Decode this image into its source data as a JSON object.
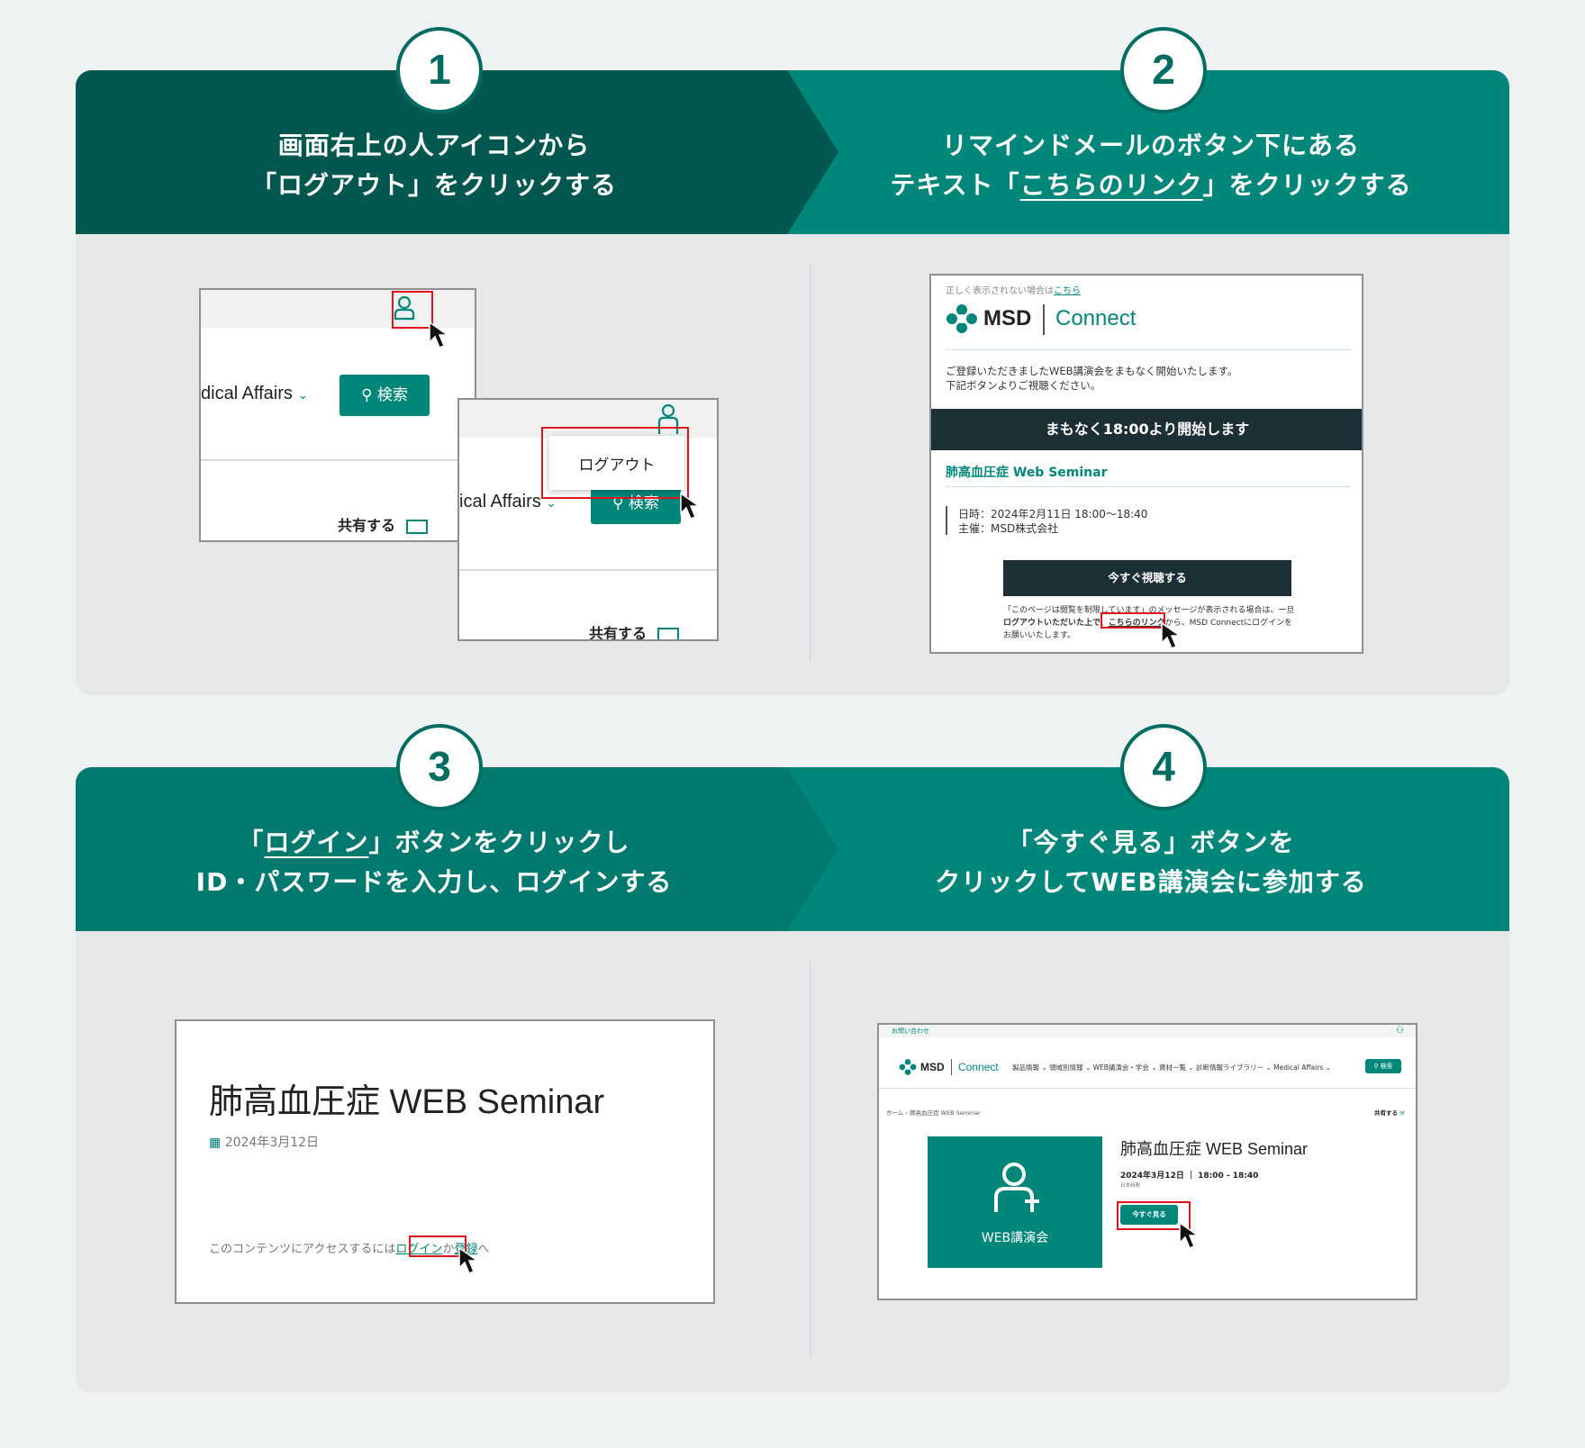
{
  "colors": {
    "accent": "#00877a",
    "dark_header": "#02574f",
    "badge": "#016c61",
    "highlight": "#e0161d",
    "banner": "#1c2f35"
  },
  "steps": [
    {
      "number": "1",
      "line1": "画面右上の人アイコンから",
      "line2": "「ログアウト」をクリックする"
    },
    {
      "number": "2",
      "line1": "リマインドメールのボタン下にある",
      "line2_pre": "テキスト「",
      "line2_link": "こちらのリンク",
      "line2_post": "」をクリックする"
    },
    {
      "number": "3",
      "line1_pre": "「",
      "line1_link": "ログイン",
      "line1_post": "」ボタンをクリックし",
      "line2": "ID・パスワードを入力し、ログインする"
    },
    {
      "number": "4",
      "line1": "「今すぐ見る」ボタンを",
      "line2": "クリックしてWEB講演会に参加する"
    }
  ],
  "shot1": {
    "nav_text": "dical Affairs",
    "search_label": "検索",
    "share_label": "共有する",
    "logout_label": "ログアウト",
    "nav_text2": "ical Affairs",
    "search_label2": "検索",
    "share_label2": "共有する",
    "icons": [
      "user-icon",
      "search-icon",
      "chevron-down-icon",
      "mail-icon",
      "cursor-icon"
    ]
  },
  "shot2": {
    "top_note_pre": "正しく表示されない場合は",
    "top_note_link": "こちら",
    "brand": "MSD",
    "product": "Connect",
    "intro1": "ご登録いただきましたWEB講演会をまもなく開始いたします。",
    "intro2": "下記ボタンよりご視聴ください。",
    "banner": "まもなく18:00より開始します",
    "seminar": "肺高血圧症 Web Seminar",
    "datetime": "日時：2024年2月11日 18:00〜18:40",
    "host": "主催：MSD株式会社",
    "watch_button": "今すぐ視聴する",
    "note1": "「このページは閲覧を制限しています」のメッセージが表示される場合は、一旦",
    "note2_bold": "ログアウトいただいた上で、",
    "note2_link": "こちらのリンク",
    "note2_post": "から、MSD Connectにログインを",
    "note3": "お願いいたします。"
  },
  "shot3": {
    "title": "肺高血圧症 WEB Seminar",
    "date": "2024年3月12日",
    "access_pre": "このコンテンツにアクセスするには",
    "login_link": "ログイン",
    "access_mid": "か",
    "register_link": "登録",
    "access_post": "へ"
  },
  "shot4": {
    "contact": "お問い合わせ",
    "brand": "MSD",
    "product": "Connect",
    "nav": [
      "製品情報",
      "領域別情報",
      "WEB講演会・学会",
      "資材一覧",
      "診断情報ライブラリー",
      "Medical Affairs"
    ],
    "search": "検索",
    "breadcrumb_home": "ホーム",
    "breadcrumb_sep": "›",
    "breadcrumb_current": "肺高血圧症 WEB Seminar",
    "share": "共有する",
    "thumb_label": "WEB講演会",
    "title": "肺高血圧症 WEB Seminar",
    "date": "2024年3月12日",
    "time": "18:00 - 18:40",
    "tz": "日本時間",
    "watch_now": "今すぐ見る"
  }
}
